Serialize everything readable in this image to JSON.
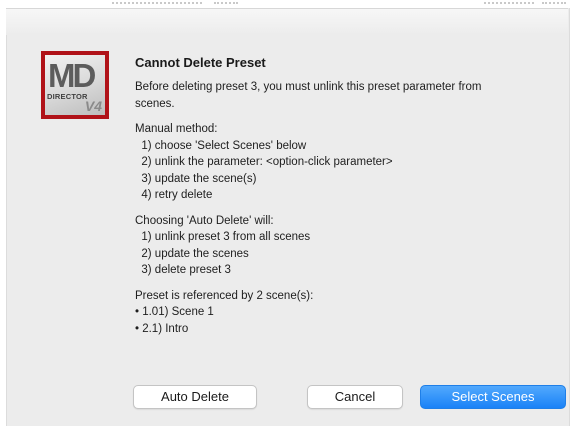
{
  "dialog": {
    "title": "Cannot Delete Preset",
    "icon": {
      "name": "md-director-v4-app-icon",
      "logo_text": "MD",
      "sub_text": "DIRECTOR",
      "version_text": "V4",
      "accent_color": "#b01218"
    },
    "message_lines": [
      "Before deleting preset 3, you must unlink this preset parameter from",
      "scenes.",
      "",
      "Manual method:",
      "  1) choose 'Select Scenes' below",
      "  2) unlink the parameter: <option-click parameter>",
      "  3) update the scene(s)",
      "  4) retry delete",
      "",
      "Choosing 'Auto Delete' will:",
      "  1) unlink preset 3 from all scenes",
      "  2) update the scenes",
      "  3) delete preset 3",
      "",
      "Preset is referenced by 2 scene(s):",
      "• 1.01) Scene 1",
      "• 2.1) Intro"
    ],
    "buttons": {
      "auto_delete": "Auto Delete",
      "cancel": "Cancel",
      "select_scenes": "Select Scenes"
    },
    "colors": {
      "background": "#ececec",
      "default_button": "#1a82f7"
    }
  }
}
